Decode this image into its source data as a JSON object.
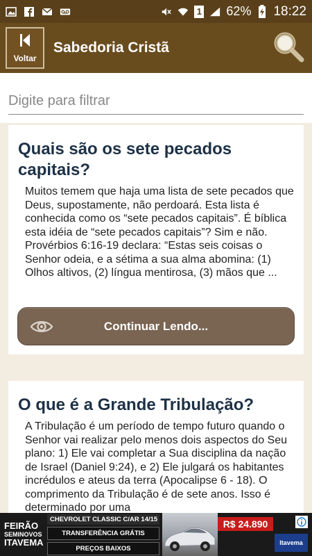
{
  "status_bar": {
    "battery": "62%",
    "time": "18:22",
    "sim_slot": "1"
  },
  "app_bar": {
    "back_label": "Voltar",
    "title": "Sabedoria Cristã"
  },
  "filter": {
    "placeholder": "Digite para filtrar",
    "value": ""
  },
  "cards": [
    {
      "title": "Quais são os sete pecados capitais?",
      "text": "Muitos temem que haja uma lista de sete pecados que Deus, supostamente, não perdoará. Esta lista é conhecida como os “sete pecados capitais”. É bíblica esta idéia de “sete pecados capitais”? Sim e não. Provérbios 6:16-19 declara: “Estas seis coisas o Senhor odeia, e a sétima a sua alma abomina: (1) Olhos altivos, (2) língua mentirosa, (3) mãos que ...",
      "button_label": "Continuar Lendo..."
    },
    {
      "title": "O que é a Grande Tribulação?",
      "text": "A Tribulação é um período de tempo futuro quando o Senhor vai realizar pelo menos dois aspectos do Seu plano: 1) Ele vai completar a Sua disciplina da nação de Israel (Daniel 9:24), e 2) Ele julgará os habitantes incrédulos e ateus da terra (Apocalipse 6 - 18). O comprimento da Tribulação é de sete anos. Isso é determinado por uma"
    }
  ],
  "ad": {
    "logo_line1": "FEIRÃO",
    "logo_line2": "SEMINOVOS",
    "logo_line3": "ITAVEMA",
    "model": "CHEVROLET CLASSIC C/AR 14/15",
    "offer1": "TRANSFERÊNCIA GRÁTIS",
    "offer2": "PREÇOS BAIXOS",
    "price": "R$ 24.890",
    "brand": "Itavema"
  },
  "colors": {
    "status_bar": "#59401b",
    "app_bar": "#694c1e",
    "background": "#f3ece0",
    "title_text": "#1d3146",
    "button": "#7a6452"
  }
}
